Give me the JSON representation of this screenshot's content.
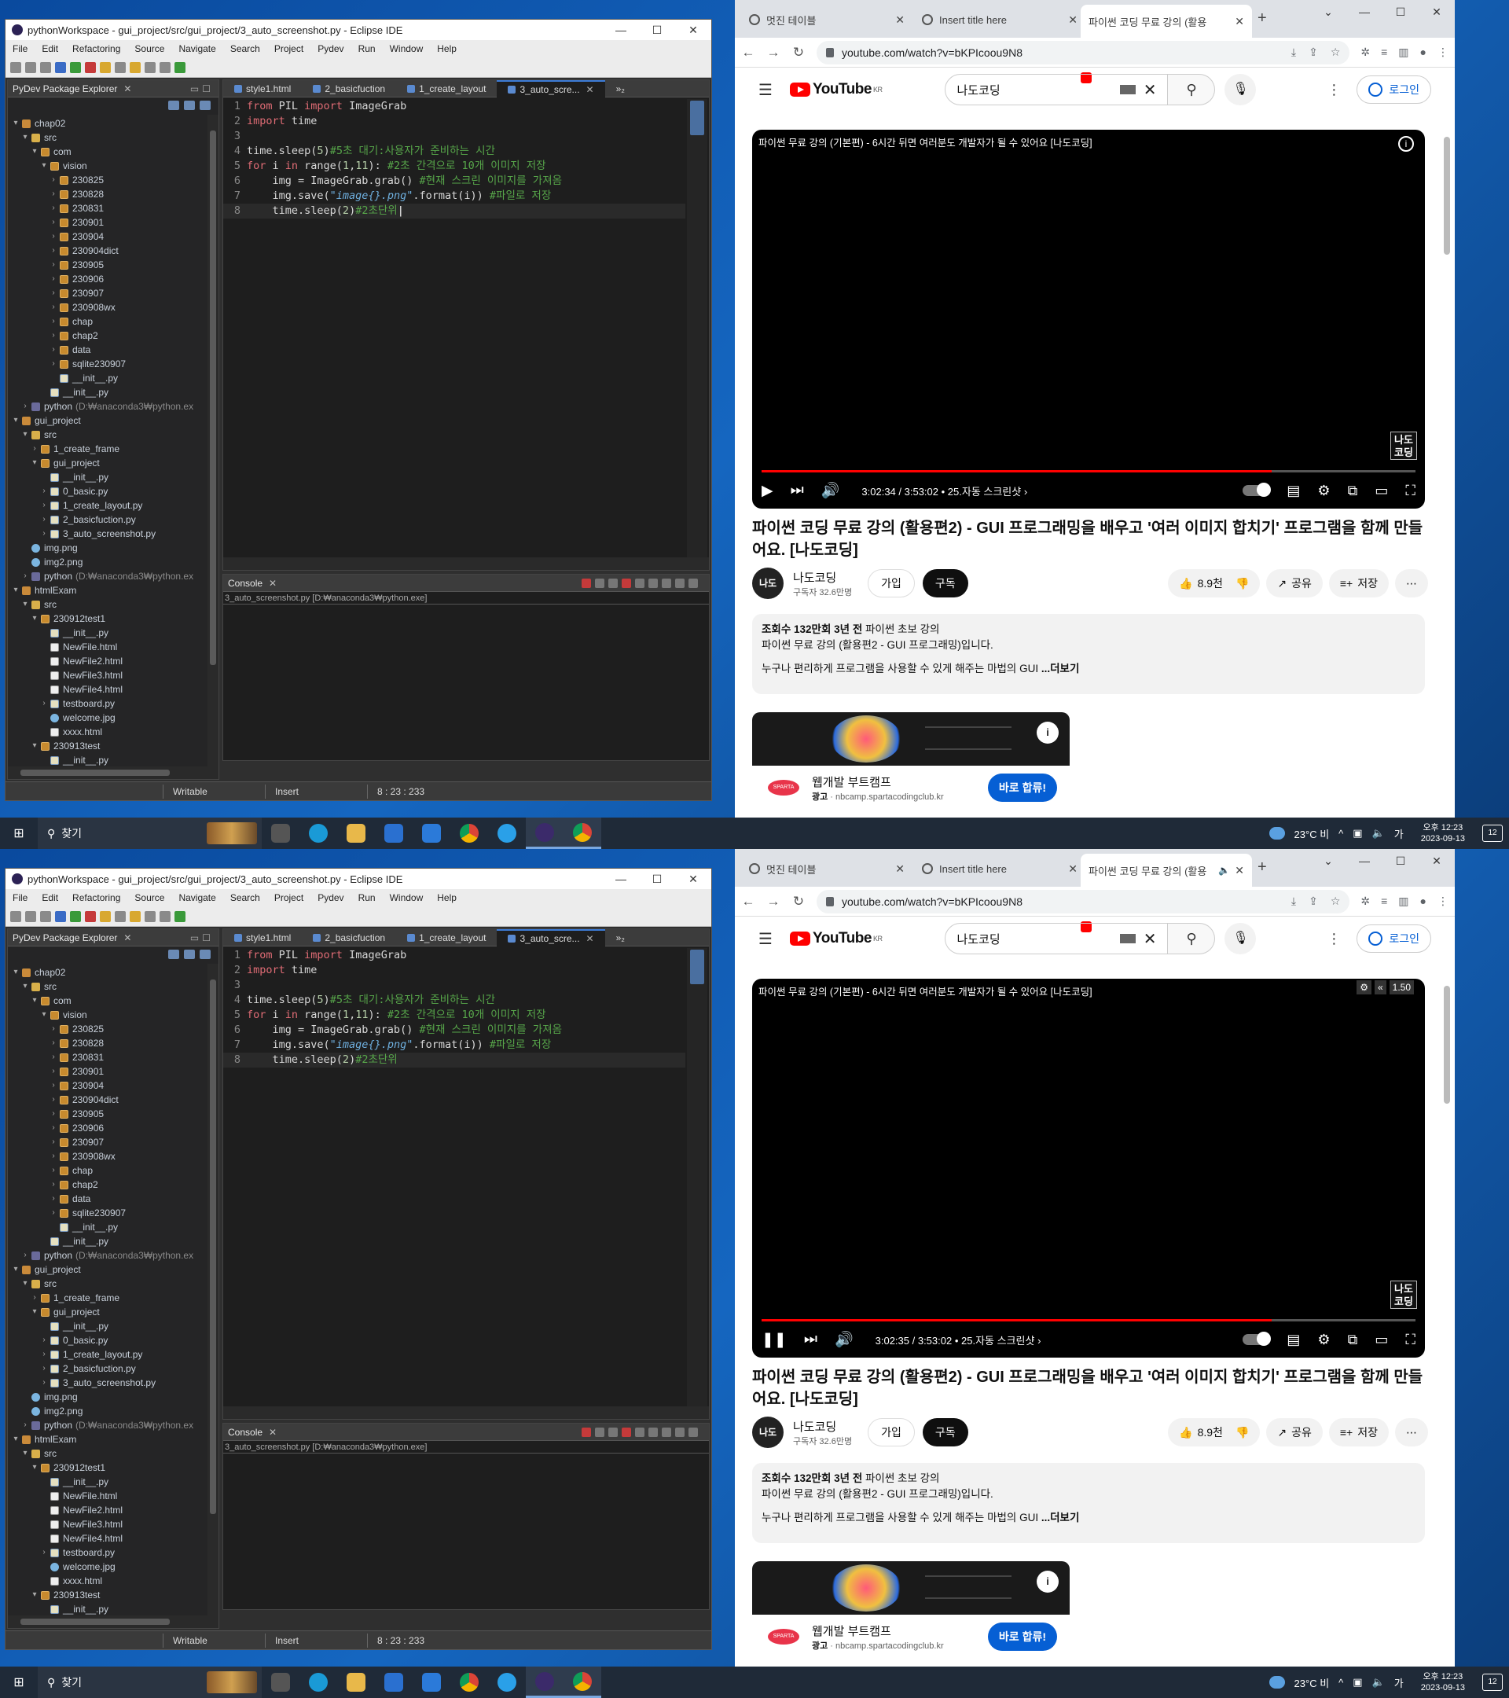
{
  "eclipse": {
    "title": "pythonWorkspace - gui_project/src/gui_project/3_auto_screenshot.py - Eclipse IDE",
    "menu": [
      "File",
      "Edit",
      "Refactoring",
      "Source",
      "Navigate",
      "Search",
      "Project",
      "Pydev",
      "Run",
      "Window",
      "Help"
    ],
    "explorer_tab": "PyDev Package Explorer",
    "tree": [
      {
        "label": "chap02",
        "indent": 0,
        "arrow": "▾",
        "icon": "proj"
      },
      {
        "label": "src",
        "indent": 1,
        "arrow": "▾",
        "icon": "folder"
      },
      {
        "label": "com",
        "indent": 2,
        "arrow": "▾",
        "icon": "pkg"
      },
      {
        "label": "vision",
        "indent": 3,
        "arrow": "▾",
        "icon": "pkg"
      },
      {
        "label": "230825",
        "indent": 4,
        "arrow": "›",
        "icon": "pkg"
      },
      {
        "label": "230828",
        "indent": 4,
        "arrow": "›",
        "icon": "pkg"
      },
      {
        "label": "230831",
        "indent": 4,
        "arrow": "›",
        "icon": "pkg"
      },
      {
        "label": "230901",
        "indent": 4,
        "arrow": "›",
        "icon": "pkg"
      },
      {
        "label": "230904",
        "indent": 4,
        "arrow": "›",
        "icon": "pkg"
      },
      {
        "label": "230904dict",
        "indent": 4,
        "arrow": "›",
        "icon": "pkg"
      },
      {
        "label": "230905",
        "indent": 4,
        "arrow": "›",
        "icon": "pkg"
      },
      {
        "label": "230906",
        "indent": 4,
        "arrow": "›",
        "icon": "pkg"
      },
      {
        "label": "230907",
        "indent": 4,
        "arrow": "›",
        "icon": "pkg"
      },
      {
        "label": "230908wx",
        "indent": 4,
        "arrow": "›",
        "icon": "pkg"
      },
      {
        "label": "chap",
        "indent": 4,
        "arrow": "›",
        "icon": "pkg"
      },
      {
        "label": "chap2",
        "indent": 4,
        "arrow": "›",
        "icon": "pkg"
      },
      {
        "label": "data",
        "indent": 4,
        "arrow": "›",
        "icon": "pkg"
      },
      {
        "label": "sqlite230907",
        "indent": 4,
        "arrow": "›",
        "icon": "pkg"
      },
      {
        "label": "__init__.py",
        "indent": 4,
        "arrow": "",
        "icon": "py"
      },
      {
        "label": "__init__.py",
        "indent": 3,
        "arrow": "",
        "icon": "py"
      },
      {
        "label": "python",
        "suffix": "(D:₩anaconda3₩python.ex",
        "indent": 1,
        "arrow": "›",
        "icon": "lib"
      },
      {
        "label": "gui_project",
        "indent": 0,
        "arrow": "▾",
        "icon": "proj"
      },
      {
        "label": "src",
        "indent": 1,
        "arrow": "▾",
        "icon": "folder"
      },
      {
        "label": "1_create_frame",
        "indent": 2,
        "arrow": "›",
        "icon": "pkg"
      },
      {
        "label": "gui_project",
        "indent": 2,
        "arrow": "▾",
        "icon": "pkg"
      },
      {
        "label": "__init__.py",
        "indent": 3,
        "arrow": "",
        "icon": "py"
      },
      {
        "label": "0_basic.py",
        "indent": 3,
        "arrow": "›",
        "icon": "py"
      },
      {
        "label": "1_create_layout.py",
        "indent": 3,
        "arrow": "›",
        "icon": "py"
      },
      {
        "label": "2_basicfuction.py",
        "indent": 3,
        "arrow": "›",
        "icon": "py"
      },
      {
        "label": "3_auto_screenshot.py",
        "indent": 3,
        "arrow": "›",
        "icon": "py"
      },
      {
        "label": "img.png",
        "indent": 1,
        "arrow": "",
        "icon": "img"
      },
      {
        "label": "img2.png",
        "indent": 1,
        "arrow": "",
        "icon": "img"
      },
      {
        "label": "python",
        "suffix": "(D:₩anaconda3₩python.ex",
        "indent": 1,
        "arrow": "›",
        "icon": "lib"
      },
      {
        "label": "htmlExam",
        "indent": 0,
        "arrow": "▾",
        "icon": "proj"
      },
      {
        "label": "src",
        "indent": 1,
        "arrow": "▾",
        "icon": "folder"
      },
      {
        "label": "230912test1",
        "indent": 2,
        "arrow": "▾",
        "icon": "pkg"
      },
      {
        "label": "__init__.py",
        "indent": 3,
        "arrow": "",
        "icon": "py"
      },
      {
        "label": "NewFile.html",
        "indent": 3,
        "arrow": "",
        "icon": "html"
      },
      {
        "label": "NewFile2.html",
        "indent": 3,
        "arrow": "",
        "icon": "html"
      },
      {
        "label": "NewFile3.html",
        "indent": 3,
        "arrow": "",
        "icon": "html"
      },
      {
        "label": "NewFile4.html",
        "indent": 3,
        "arrow": "",
        "icon": "html"
      },
      {
        "label": "testboard.py",
        "indent": 3,
        "arrow": "›",
        "icon": "py"
      },
      {
        "label": "welcome.jpg",
        "indent": 3,
        "arrow": "",
        "icon": "img"
      },
      {
        "label": "xxxx.html",
        "indent": 3,
        "arrow": "",
        "icon": "html"
      },
      {
        "label": "230913test",
        "indent": 2,
        "arrow": "▾",
        "icon": "pkg"
      },
      {
        "label": "__init__.py",
        "indent": 3,
        "arrow": "",
        "icon": "py"
      }
    ],
    "editor_tabs": [
      "style1.html",
      "2_basicfuction",
      "1_create_layout",
      "3_auto_scre..."
    ],
    "editor_tab_overflow": "»₂",
    "code_lines": [
      [
        {
          "c": "kw",
          "t": "from "
        },
        {
          "c": "fn",
          "t": "PIL "
        },
        {
          "c": "kw",
          "t": "import "
        },
        {
          "c": "fn",
          "t": "ImageGrab"
        }
      ],
      [
        {
          "c": "kw",
          "t": "import "
        },
        {
          "c": "fn",
          "t": "time"
        }
      ],
      [],
      [
        {
          "c": "fn",
          "t": "time.sleep("
        },
        {
          "c": "num",
          "t": "5"
        },
        {
          "c": "fn",
          "t": ")"
        },
        {
          "c": "cm",
          "t": "#5초 대기:사용자가 준비하는 시간"
        }
      ],
      [
        {
          "c": "kw",
          "t": "for "
        },
        {
          "c": "fn",
          "t": "i "
        },
        {
          "c": "kw",
          "t": "in "
        },
        {
          "c": "fn",
          "t": "range("
        },
        {
          "c": "num",
          "t": "1"
        },
        {
          "c": "fn",
          "t": ","
        },
        {
          "c": "num",
          "t": "11"
        },
        {
          "c": "fn",
          "t": "): "
        },
        {
          "c": "cm",
          "t": "#2초 간격으로 10개 이미지 저장"
        }
      ],
      [
        {
          "c": "fn",
          "t": "    img = ImageGrab.grab() "
        },
        {
          "c": "cm",
          "t": "#현재 스크린 이미지를 가져옴"
        }
      ],
      [
        {
          "c": "fn",
          "t": "    img.save("
        },
        {
          "c": "str",
          "t": "\"image{}.png\""
        },
        {
          "c": "fn",
          "t": ".format(i)) "
        },
        {
          "c": "cm",
          "t": "#파일로 저장"
        }
      ],
      [
        {
          "c": "fn",
          "t": "    time.sleep("
        },
        {
          "c": "num",
          "t": "2"
        },
        {
          "c": "fn",
          "t": ")"
        },
        {
          "c": "cm",
          "t": "#2초단위"
        }
      ]
    ],
    "console_tab": "Console",
    "console_path": "3_auto_screenshot.py [D:₩anaconda3₩python.exe]",
    "status": {
      "writable": "Writable",
      "insert": "Insert",
      "position": "8 : 23 : 233"
    }
  },
  "chrome": {
    "tabs": [
      "멋진 테이블",
      "Insert title here",
      "파이썬 코딩 무료 강의 (활용"
    ],
    "url": "youtube.com/watch?v=bKPIcoou9N8"
  },
  "youtube": {
    "logo": "YouTube",
    "region": "KR",
    "search_value": "나도코딩",
    "login": "로그인",
    "player_title": "파이썬 무료 강의 (기본편) - 6시간 뒤면 여러분도 개발자가 될 수 있어요 [나도코딩]",
    "watermark": "나도\n코딩",
    "duration": "3:53:02",
    "chapter": "25.자동 스크린샷",
    "video_title": "파이썬 코딩 무료 강의 (활용편2) - GUI 프로그래밍을 배우고 '여러 이미지 합치기' 프로그램을 함께 만들어요. [나도코딩]",
    "channel_avatar": "나도",
    "channel": "나도코딩",
    "subscribers": "구독자 32.6만명",
    "join": "가입",
    "subscribe": "구독",
    "likes": "8.9천",
    "share": "공유",
    "save": "저장",
    "desc_views": "조회수 132만회",
    "desc_age": "3년 전",
    "desc_tags": "파이썬 초보 강의",
    "desc_line1": "파이썬 무료 강의 (활용편2 - GUI 프로그래밍)입니다.",
    "desc_line2": "누구나 편리하게 프로그램을 사용할 수 있게 해주는 마법의 GUI",
    "desc_more": "...더보기",
    "ad_name": "웹개발 부트캠프",
    "ad_label": "광고",
    "ad_url": "nbcamp.spartacodingclub.kr",
    "ad_button": "바로 합류!",
    "ad_logo": "SPARTA"
  },
  "screens": [
    {
      "time_current": "3:02:34",
      "speed": "",
      "audio": false,
      "cursor": true,
      "progress": 0.78
    },
    {
      "time_current": "3:02:35",
      "speed": "1.50",
      "audio": true,
      "cursor": false,
      "progress": 0.78
    }
  ],
  "taskbar": {
    "search": "찾기",
    "weather": "23°C 비",
    "ime": "가",
    "clock_time": "오후 12:23",
    "clock_date": "2023-09-13",
    "notifications": "12"
  }
}
